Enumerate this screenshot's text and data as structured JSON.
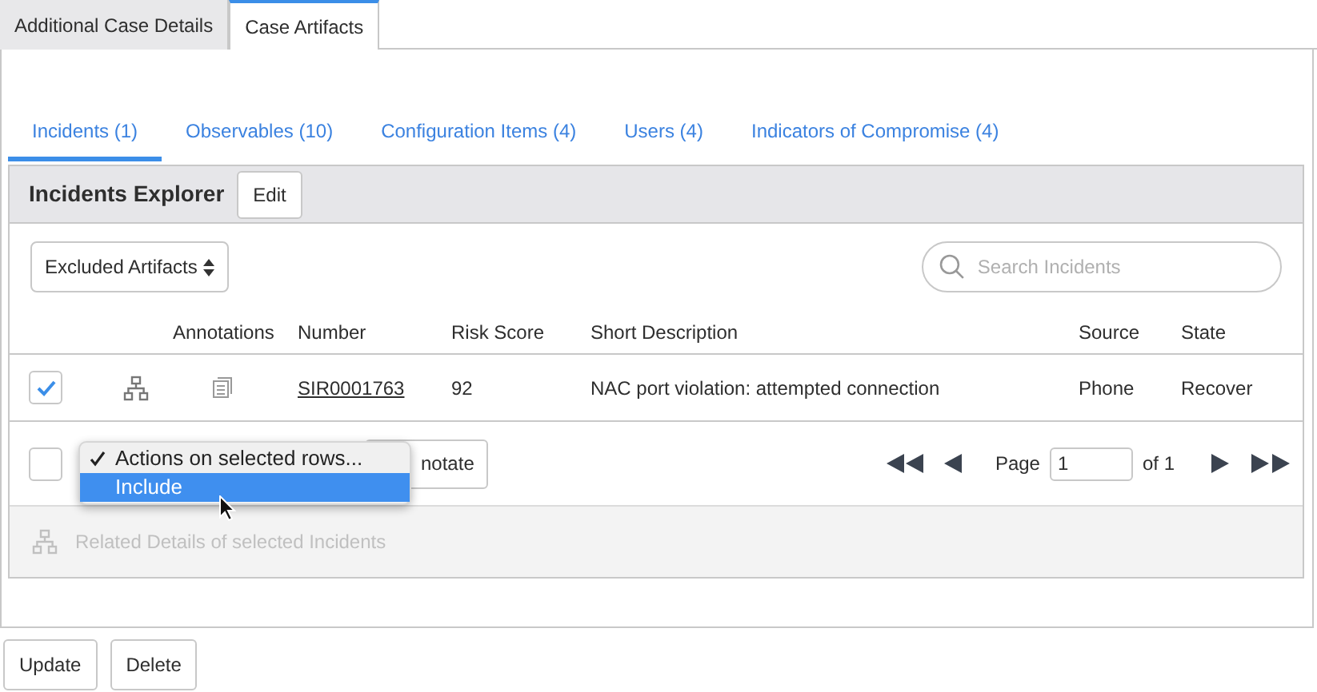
{
  "top_tabs": [
    {
      "label": "Additional Case Details",
      "selected": false
    },
    {
      "label": "Case Artifacts",
      "selected": true
    }
  ],
  "sub_tabs": [
    {
      "label": "Incidents (1)",
      "selected": true
    },
    {
      "label": "Observables (10)",
      "selected": false
    },
    {
      "label": "Configuration Items (4)",
      "selected": false
    },
    {
      "label": "Users (4)",
      "selected": false
    },
    {
      "label": "Indicators of Compromise (4)",
      "selected": false
    }
  ],
  "explorer": {
    "title": "Incidents Explorer",
    "edit_button": "Edit"
  },
  "filter": {
    "value": "Excluded Artifacts"
  },
  "search": {
    "placeholder": "Search Incidents"
  },
  "table": {
    "columns": [
      "Annotations",
      "Number",
      "Risk Score",
      "Short Description",
      "Source",
      "State"
    ],
    "rows": [
      {
        "checked": true,
        "number": "SIR0001763",
        "risk_score": "92",
        "short_description": "NAC port violation: attempted connection",
        "source": "Phone",
        "state": "Recover"
      }
    ]
  },
  "footer": {
    "select_all_checked": false,
    "actions_menu": [
      {
        "label": "Actions on selected rows...",
        "checked": true,
        "selected": false
      },
      {
        "label": "Include",
        "checked": false,
        "selected": true
      }
    ],
    "annotate_button": "notate",
    "pagination": {
      "page_label": "Page",
      "page": "1",
      "of": "of 1"
    }
  },
  "related_details": {
    "label": "Related Details of selected Incidents",
    "disabled": true
  },
  "buttons": [
    "Update",
    "Delete"
  ]
}
